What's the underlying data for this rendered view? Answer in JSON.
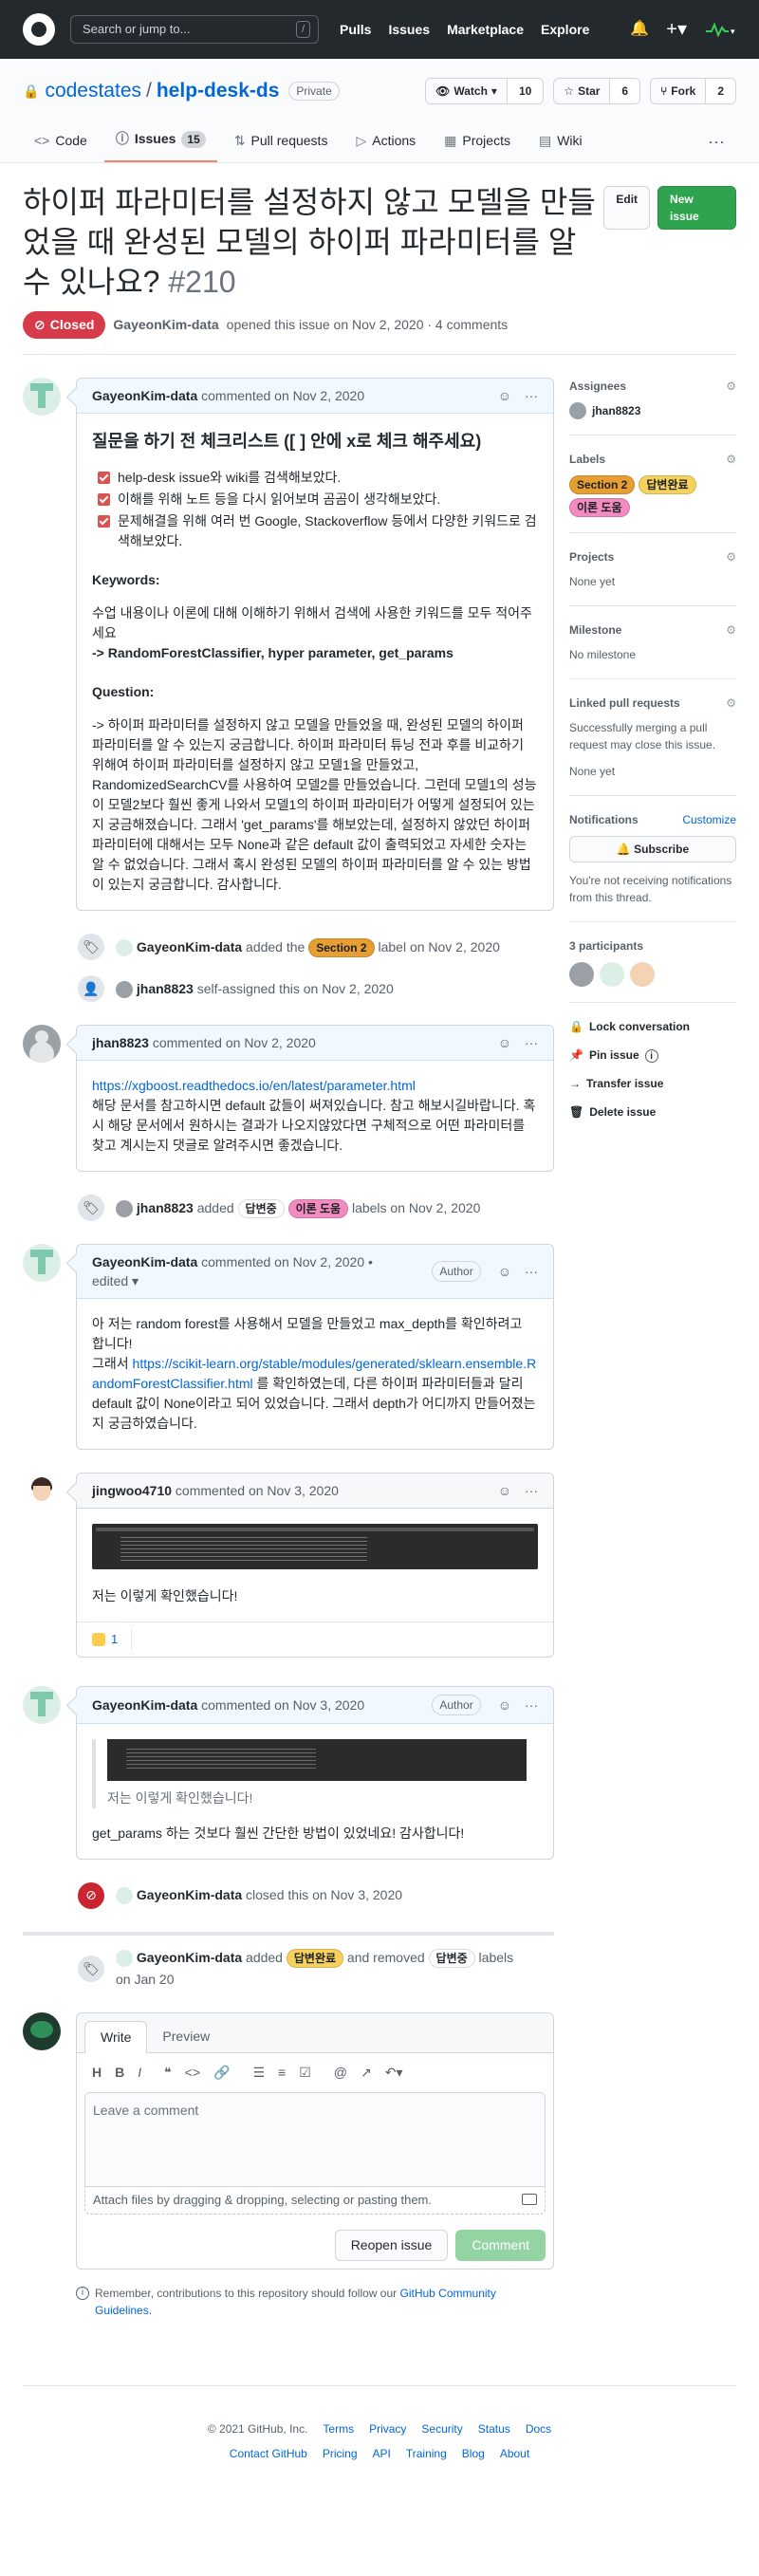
{
  "header": {
    "search_placeholder": "Search or jump to...",
    "slash": "/",
    "nav": [
      "Pulls",
      "Issues",
      "Marketplace",
      "Explore"
    ]
  },
  "repo": {
    "owner": "codestates",
    "name": "help-desk-ds",
    "visibility": "Private",
    "watch": {
      "label": "Watch",
      "count": "10"
    },
    "star": {
      "label": "Star",
      "count": "6"
    },
    "fork": {
      "label": "Fork",
      "count": "2"
    },
    "tabs": [
      {
        "label": "Code",
        "icon": "code-icon"
      },
      {
        "label": "Issues",
        "icon": "issue-icon",
        "count": "15"
      },
      {
        "label": "Pull requests",
        "icon": "pr-icon"
      },
      {
        "label": "Actions",
        "icon": "play-icon"
      },
      {
        "label": "Projects",
        "icon": "project-icon"
      },
      {
        "label": "Wiki",
        "icon": "book-icon"
      }
    ]
  },
  "issue": {
    "title": "하이퍼 파라미터를 설정하지 않고 모델을 만들었을 때 완성된 모델의 하이퍼 파라미터를 알 수 있나요?",
    "number": "#210",
    "edit_label": "Edit",
    "new_label": "New issue",
    "state": "Closed",
    "author": "GayeonKim-data",
    "opened_text": "opened this issue on Nov 2, 2020 · 4 comments"
  },
  "comment1": {
    "author": "GayeonKim-data",
    "date": "commented on Nov 2, 2020",
    "heading": "질문을 하기 전 체크리스트 ([ ] 안에 x로 체크 해주세요)",
    "checks": [
      "help-desk issue와 wiki를 검색해보았다.",
      "이해를 위해 노트 등을 다시 읽어보며 곰곰이 생각해보았다.",
      "문제해결을 위해 여러 번 Google, Stackoverflow 등에서 다양한 키워드로 검색해보았다."
    ],
    "keywords_h": "Keywords:",
    "keywords_desc": "수업 내용이나 이론에 대해 이해하기 위해서 검색에 사용한 키워드를 모두 적어주세요",
    "keywords": "-> RandomForestClassifier, hyper parameter, get_params",
    "question_h": "Question:",
    "question": "-> 하이퍼 파라미터를 설정하지 않고 모델을 만들었을 때, 완성된 모델의 하이퍼 파라미터를 알 수 있는지 궁금합니다. 하이퍼 파라미터 튜닝 전과 후를 비교하기 위해여 하이퍼 파라미터를 설정하지 않고 모델1을 만들었고, RandomizedSearchCV를 사용하여 모델2를 만들었습니다. 그런데 모델1의 성능이 모델2보다 훨씬 좋게 나와서 모델1의 하이퍼 파라미터가 어떻게 설정되어 있는지 궁금해졌습니다. 그래서 'get_params'를 해보았는데, 설정하지 않았던 하이퍼 파라미터에 대해서는 모두 None과 같은 default 값이 출력되었고 자세한 숫자는 알 수 없었습니다. 그래서 혹시 완성된 모델의 하이퍼 파라미터를 알 수 있는 방법이 있는지 궁금합니다. 감사합니다."
  },
  "event1": {
    "actor": "GayeonKim-data",
    "pre": "added the",
    "label": "Section 2",
    "post": "label on Nov 2, 2020"
  },
  "event2": {
    "actor": "jhan8823",
    "text": "self-assigned this on Nov 2, 2020"
  },
  "comment2": {
    "author": "jhan8823",
    "date": "commented on Nov 2, 2020",
    "link": "https://xgboost.readthedocs.io/en/latest/parameter.html",
    "text": "해당 문서를 참고하시면 default 값들이 써져있습니다. 참고 해보시길바랍니다. 혹시 해당 문서에서 원하시는 결과가 나오지않았다면 구체적으로 어떤 파라미터를 찾고 계시는지 댓글로 알려주시면 좋겠습니다."
  },
  "event3": {
    "actor": "jhan8823",
    "pre": "added",
    "label1": "답변중",
    "label2": "이론 도움",
    "post": "labels on Nov 2, 2020"
  },
  "comment3": {
    "author": "GayeonKim-data",
    "date": "commented on Nov 2, 2020 •",
    "edited": "edited ▾",
    "badge": "Author",
    "line1": "아 저는 random forest를 사용해서 모델을 만들었고 max_depth를 확인하려고 합니다!",
    "line2": "그래서",
    "link": "https://scikit-learn.org/stable/modules/generated/sklearn.ensemble.RandomForestClassifier.html",
    "line3": "를 확인하였는데, 다른 하이퍼 파라미터들과 달리 default 값이 None이라고 되어 있었습니다. 그래서 depth가 어디까지 만들어졌는지 궁금하였습니다."
  },
  "comment4": {
    "author": "jingwoo4710",
    "date": "commented on Nov 3, 2020",
    "text": "저는 이렇게 확인했습니다!",
    "reaction_count": "1"
  },
  "comment5": {
    "author": "GayeonKim-data",
    "date": "commented on Nov 3, 2020",
    "badge": "Author",
    "quote": "저는 이렇게 확인했습니다!",
    "text": "get_params 하는 것보다 훨씬 간단한 방법이 있었네요! 감사합니다!"
  },
  "event4": {
    "actor": "GayeonKim-data",
    "text": "closed this on Nov 3, 2020"
  },
  "event5": {
    "actor": "GayeonKim-data",
    "pre": "added",
    "label1": "답변완료",
    "mid": "and removed",
    "label2": "답변중",
    "post": "labels",
    "date": "on Jan 20"
  },
  "editor": {
    "tab_write": "Write",
    "tab_preview": "Preview",
    "placeholder": "Leave a comment",
    "attach": "Attach files by dragging & dropping, selecting or pasting them.",
    "reopen": "Reopen issue",
    "comment": "Comment",
    "note_pre": "Remember, contributions to this repository should follow our",
    "note_link": "GitHub Community Guidelines."
  },
  "sidebar": {
    "assignees_h": "Assignees",
    "assignee": "jhan8823",
    "labels_h": "Labels",
    "labels": [
      "Section 2",
      "답변완료",
      "이론 도움"
    ],
    "projects_h": "Projects",
    "projects": "None yet",
    "milestone_h": "Milestone",
    "milestone": "No milestone",
    "linked_h": "Linked pull requests",
    "linked_desc": "Successfully merging a pull request may close this issue.",
    "linked": "None yet",
    "notif_h": "Notifications",
    "notif_custom": "Customize",
    "subscribe": "Subscribe",
    "notif_desc": "You're not receiving notifications from this thread.",
    "participants_h": "3 participants",
    "lock": "Lock conversation",
    "pin": "Pin issue",
    "transfer": "Transfer issue",
    "delete": "Delete issue"
  },
  "footer": {
    "copyright": "© 2021 GitHub, Inc.",
    "row1": [
      "Terms",
      "Privacy",
      "Security",
      "Status",
      "Docs"
    ],
    "row2": [
      "Contact GitHub",
      "Pricing",
      "API",
      "Training",
      "Blog",
      "About"
    ]
  }
}
